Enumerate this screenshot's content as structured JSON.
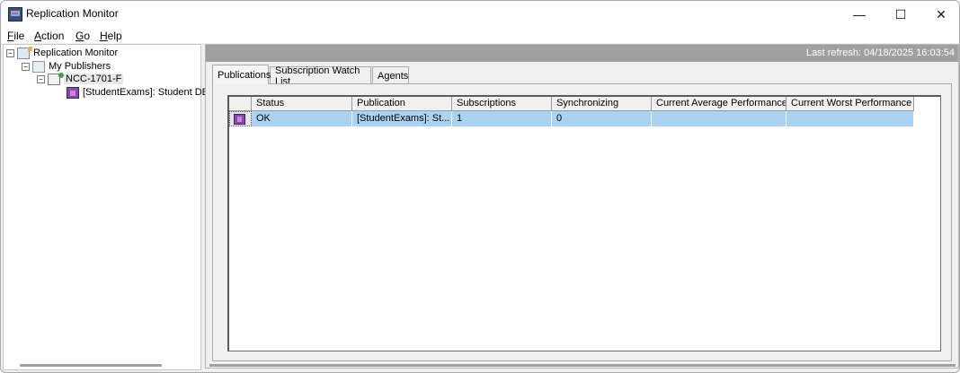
{
  "window": {
    "title": "Replication Monitor",
    "controls": {
      "minimize": "—",
      "maximize": "☐",
      "close": "✕"
    }
  },
  "menu": [
    {
      "accel": "F",
      "rest": "ile"
    },
    {
      "accel": "A",
      "rest": "ction"
    },
    {
      "accel": "G",
      "rest": "o"
    },
    {
      "accel": "H",
      "rest": "elp"
    }
  ],
  "tree": {
    "root": "Replication Monitor",
    "publishers": "My Publishers",
    "server": "NCC-1701-F",
    "publication": "[StudentExams]: Student DB"
  },
  "status": {
    "last_refresh": "Last refresh: 04/18/2025 16:03:54"
  },
  "tabs": [
    "Publications",
    "Subscription Watch List",
    "Agents"
  ],
  "grid": {
    "columns": [
      "Status",
      "Publication",
      "Subscriptions",
      "Synchronizing",
      "Current Average Performance",
      "Current Worst Performance"
    ],
    "rows": [
      {
        "status": "OK",
        "publication": "[StudentExams]: St...",
        "subscriptions": "1",
        "synchronizing": "0",
        "avg_perf": "",
        "worst_perf": ""
      }
    ]
  },
  "colors": {
    "selection": "#aad3f3",
    "status_strip": "#a0a0a0"
  }
}
